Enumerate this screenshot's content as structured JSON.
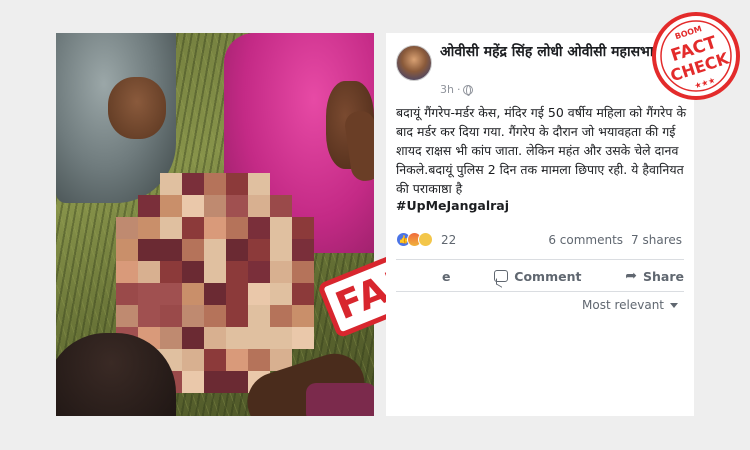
{
  "post": {
    "page_name": "ओवीसी महेंद्र सिंह लोधी ओवीसी महासभा",
    "time": "3h",
    "time_suffix": "·",
    "body": "बदायूं गैंगरेप-मर्डर केस, मंदिर गई 50 वर्षीय महिला को गैंगरेप के बाद मर्डर कर दिया गया. गैंगरेप के दौरान जो भयावहता की गई शायद राक्षस भी कांप जाता. लेकिन महंत और उसके चेले दानव निकले.बदायूं पुलिस 2 दिन तक मामला छिपाए रही. ये हैवानियत की पराकाष्ठा है",
    "hashtag": "#UpMeJangalraj",
    "reactions": {
      "icons": [
        "like-icon",
        "angry-icon",
        "sad-icon"
      ],
      "count": "22"
    },
    "comments": "6 comments",
    "shares": "7 shares",
    "actions": {
      "like": "e",
      "comment": "Comment",
      "share": "Share"
    },
    "sort_label": "Most relevant"
  },
  "overlay": {
    "stamp": "FAKE"
  },
  "badge": {
    "brand": "BOOM",
    "line1": "FACT",
    "line2": "CHECK",
    "stars": "★★★"
  },
  "colors": {
    "stamp_red": "#d8262e",
    "badge_red": "#e32b2b",
    "text_dark": "#1c1e21",
    "text_gray": "#606770"
  }
}
